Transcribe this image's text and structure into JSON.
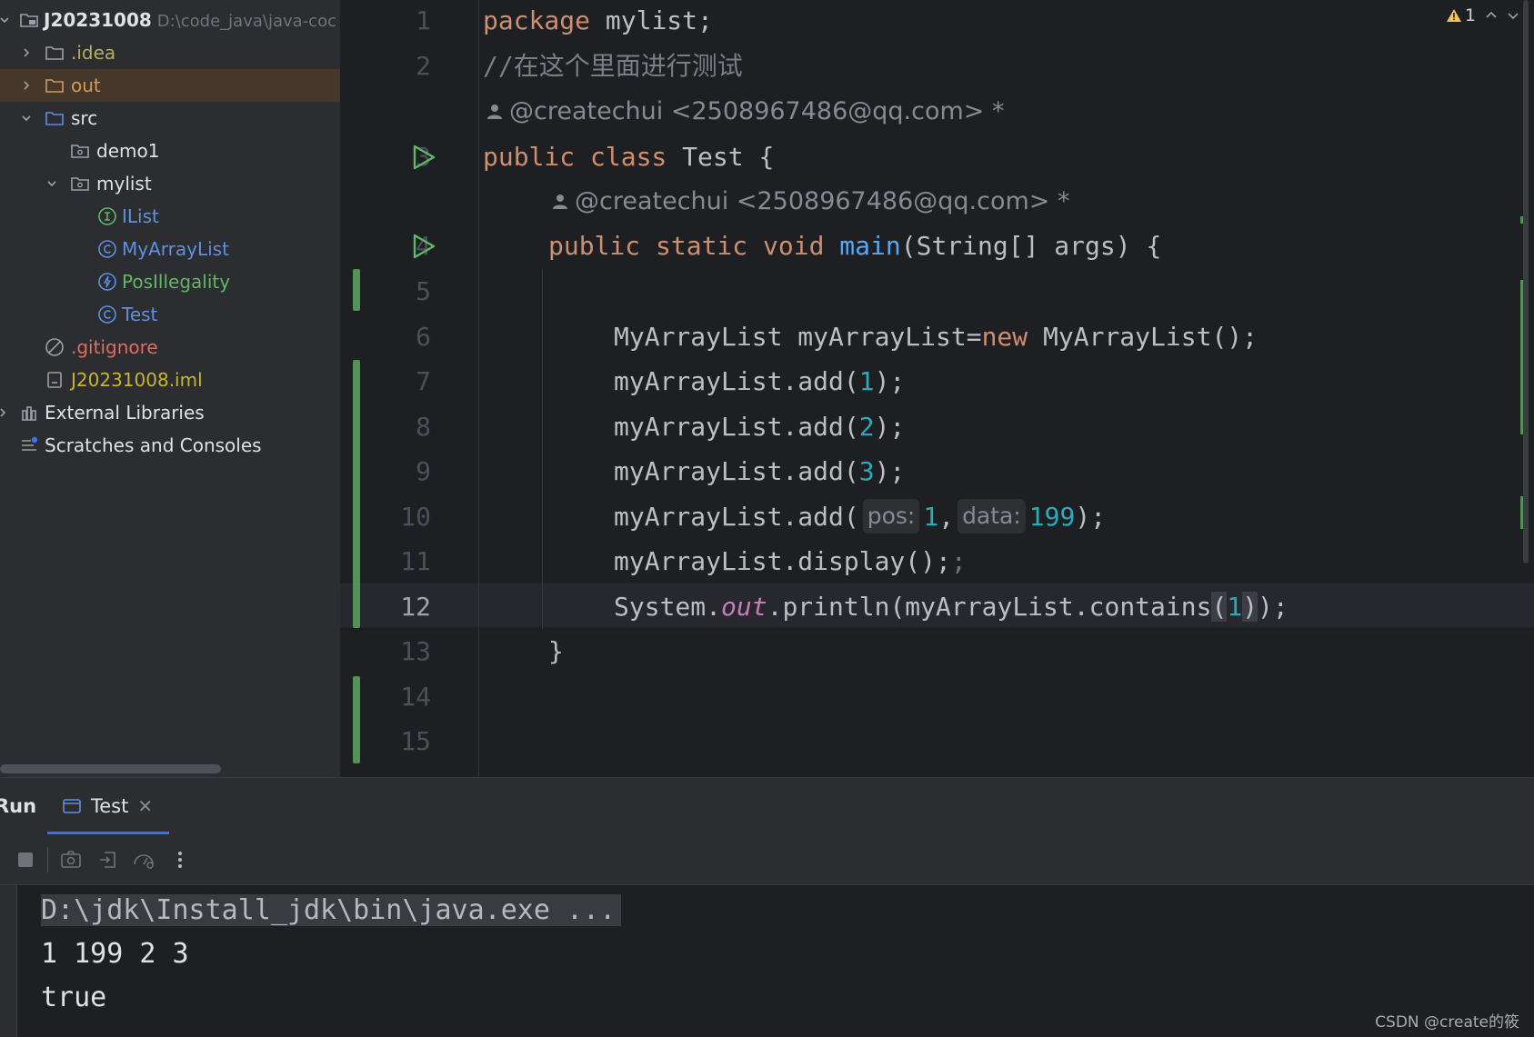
{
  "project": {
    "root_name": "J20231008",
    "root_path": "D:\\code_java\\java-coc",
    "items": [
      {
        "label": ".idea",
        "icon": "folder-icon",
        "color": "#b3ae60"
      },
      {
        "label": "out",
        "icon": "folder-icon",
        "color": "#d19a5b"
      },
      {
        "label": "src",
        "icon": "source-folder-icon",
        "color": "#dfe1e5"
      },
      {
        "label": "demo1",
        "icon": "package-icon",
        "color": "#dfe1e5"
      },
      {
        "label": "mylist",
        "icon": "package-icon",
        "color": "#dfe1e5"
      },
      {
        "label": "IList",
        "icon": "interface-icon",
        "color": "#5f8fe0"
      },
      {
        "label": "MyArrayList",
        "icon": "class-icon",
        "color": "#5f8fe0"
      },
      {
        "label": "PosIllegality",
        "icon": "exception-class-icon",
        "color": "#5fb865"
      },
      {
        "label": "Test",
        "icon": "class-icon",
        "color": "#5f8fe0"
      },
      {
        "label": ".gitignore",
        "icon": "ignored-file-icon",
        "color": "#e06d5e"
      },
      {
        "label": "J20231008.iml",
        "icon": "module-file-icon",
        "color": "#c9b52d"
      },
      {
        "label": "External Libraries",
        "icon": "libraries-icon",
        "color": "#dfe1e5"
      },
      {
        "label": "Scratches and Consoles",
        "icon": "scratches-icon",
        "color": "#dfe1e5"
      }
    ]
  },
  "editor": {
    "warning_count": "1",
    "line_numbers": [
      "1",
      "2",
      "3",
      "4",
      "5",
      "6",
      "7",
      "8",
      "9",
      "10",
      "11",
      "12",
      "13",
      "14",
      "15"
    ],
    "author_1": "@createchui <2508967486@qq.com> *",
    "author_2": "@createchui <2508967486@qq.com> *",
    "code": {
      "l1_kw": "package",
      "l1_rest": " mylist;",
      "l2": "//在这个里面进行测试",
      "l3_kw": "public class",
      "l3_rest": " Test {",
      "l4_kw": "public static void",
      "l4_fn": "main",
      "l4_rest": "(String[] args) {",
      "l6_a": "MyArrayList myArrayList=",
      "l6_kw": "new",
      "l6_b": " MyArrayList();",
      "l7_a": "myArrayList.add(",
      "l7_n": "1",
      "l7_b": ");",
      "l8_a": "myArrayList.add(",
      "l8_n": "2",
      "l8_b": ");",
      "l9_a": "myArrayList.add(",
      "l9_n": "3",
      "l9_b": ");",
      "l10_a": "myArrayList.add(",
      "l10_hint1": "pos:",
      "l10_n1": "1",
      "l10_comma": ",",
      "l10_hint2": "data:",
      "l10_n2": "199",
      "l10_b": ");",
      "l11_a": "myArrayList.display();",
      "l11_b": ";",
      "l12_a": "System.",
      "l12_out": "out",
      "l12_b": ".println(myArrayList.contains",
      "l12_p1": "(",
      "l12_n": "1",
      "l12_p2": ")",
      "l12_c": ");",
      "l13": "}"
    }
  },
  "run": {
    "title": "Run",
    "tab_label": "Test",
    "console": {
      "command": "D:\\jdk\\Install_jdk\\bin\\java.exe ...",
      "output_1": "1 199 2 3",
      "output_2": "true"
    }
  },
  "watermark": "CSDN @create的筱",
  "colors": {
    "keyword": "#cf8e6d",
    "comment": "#7a7e85",
    "function": "#56a8f5",
    "number": "#2aacb8",
    "static_field": "#c77dba",
    "vcs_added": "#549159",
    "run_green": "#5fb865"
  }
}
